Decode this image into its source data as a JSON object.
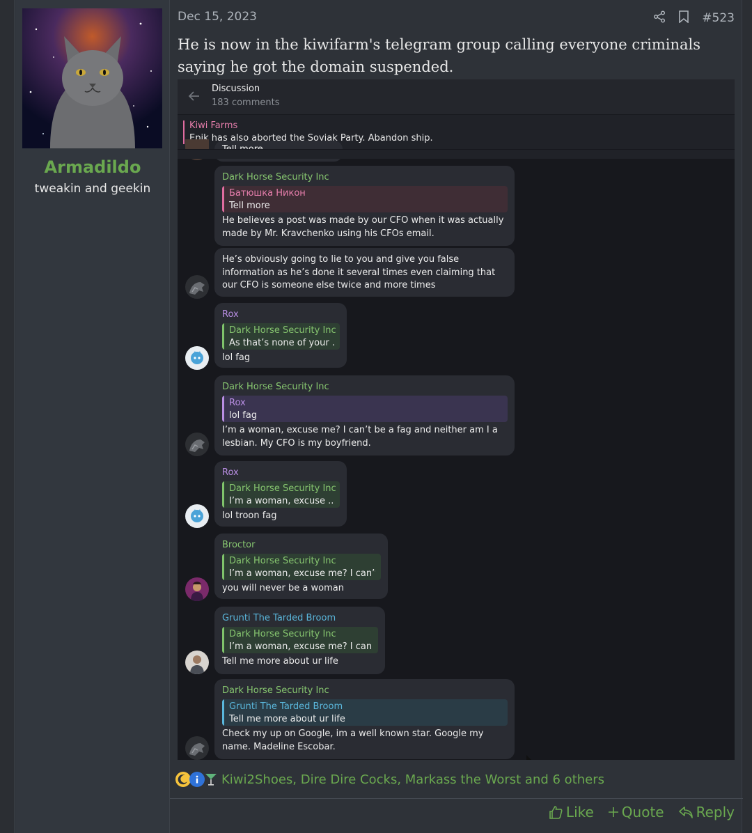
{
  "user": {
    "name": "Armadildo",
    "title": "tweakin and geekin"
  },
  "post": {
    "date": "Dec 15, 2023",
    "number": "#523",
    "message": "He is now in the kiwifarm's telegram group calling everyone criminals saying he got the domain suspended.",
    "reactions_text": "Kiwi2Shoes, Dire Dire Cocks, Markass the Worst and 6 others",
    "reaction_icons": [
      "moon-icon",
      "info-icon",
      "cocktail-icon"
    ],
    "actions": {
      "like": "Like",
      "quote": "Quote",
      "reply": "Reply"
    }
  },
  "telegram": {
    "header_title": "Discussion",
    "header_sub": "183 comments",
    "pinned_title": "Kiwi Farms",
    "pinned_text": "Epik has also aborted the Soyjak Party. Abandon ship.",
    "cut_text": "Tell more",
    "messages": [
      {
        "sender": "Dark Horse Security Inc",
        "quote_sender": "Батюшка Никон",
        "quote_text": "Tell more",
        "text": "He believes a post was made by our CFO when it was actually made by Mr. Kravchenko using his CFOs email."
      },
      {
        "text": "He’s obviously going to lie to you and give you false information as he’s done it several times even claiming that our CFO is someone else twice and more times"
      },
      {
        "sender": "Rox",
        "quote_sender": "Dark Horse Security Inc",
        "quote_text": "As that’s none of your ...",
        "text": "lol fag"
      },
      {
        "sender": "Dark Horse Security Inc",
        "quote_sender": "Rox",
        "quote_text": "lol fag",
        "text": "I’m a woman, excuse me? I can’t be a fag and neither am I a lesbian. My CFO is my boyfriend."
      },
      {
        "sender": "Rox",
        "quote_sender": "Dark Horse Security Inc",
        "quote_text": "I’m a woman, excuse ...",
        "text": "lol troon fag"
      },
      {
        "sender": "Broctor",
        "quote_sender": "Dark Horse Security Inc",
        "quote_text": "I’m a woman, excuse me? I can’t...",
        "text": "you will never be a woman"
      },
      {
        "sender": "Grunti The Tarded Broom",
        "quote_sender": "Dark Horse Security Inc",
        "quote_text": "I’m a woman, excuse me? I can’...",
        "text": "Tell me more about ur life"
      },
      {
        "sender": "Dark Horse Security Inc",
        "quote_sender": "Grunti The Tarded Broom",
        "quote_text": "Tell me more about ur life",
        "text": "Check my up on Google, im a well known star. Google my name. Madeline Escobar."
      }
    ]
  },
  "colors": {
    "username_green": "#6aa84f",
    "tg_green": "#86c56f",
    "tg_pink": "#e87fad",
    "tg_purple": "#b98ee3",
    "tg_cyan": "#5ab7dc"
  }
}
